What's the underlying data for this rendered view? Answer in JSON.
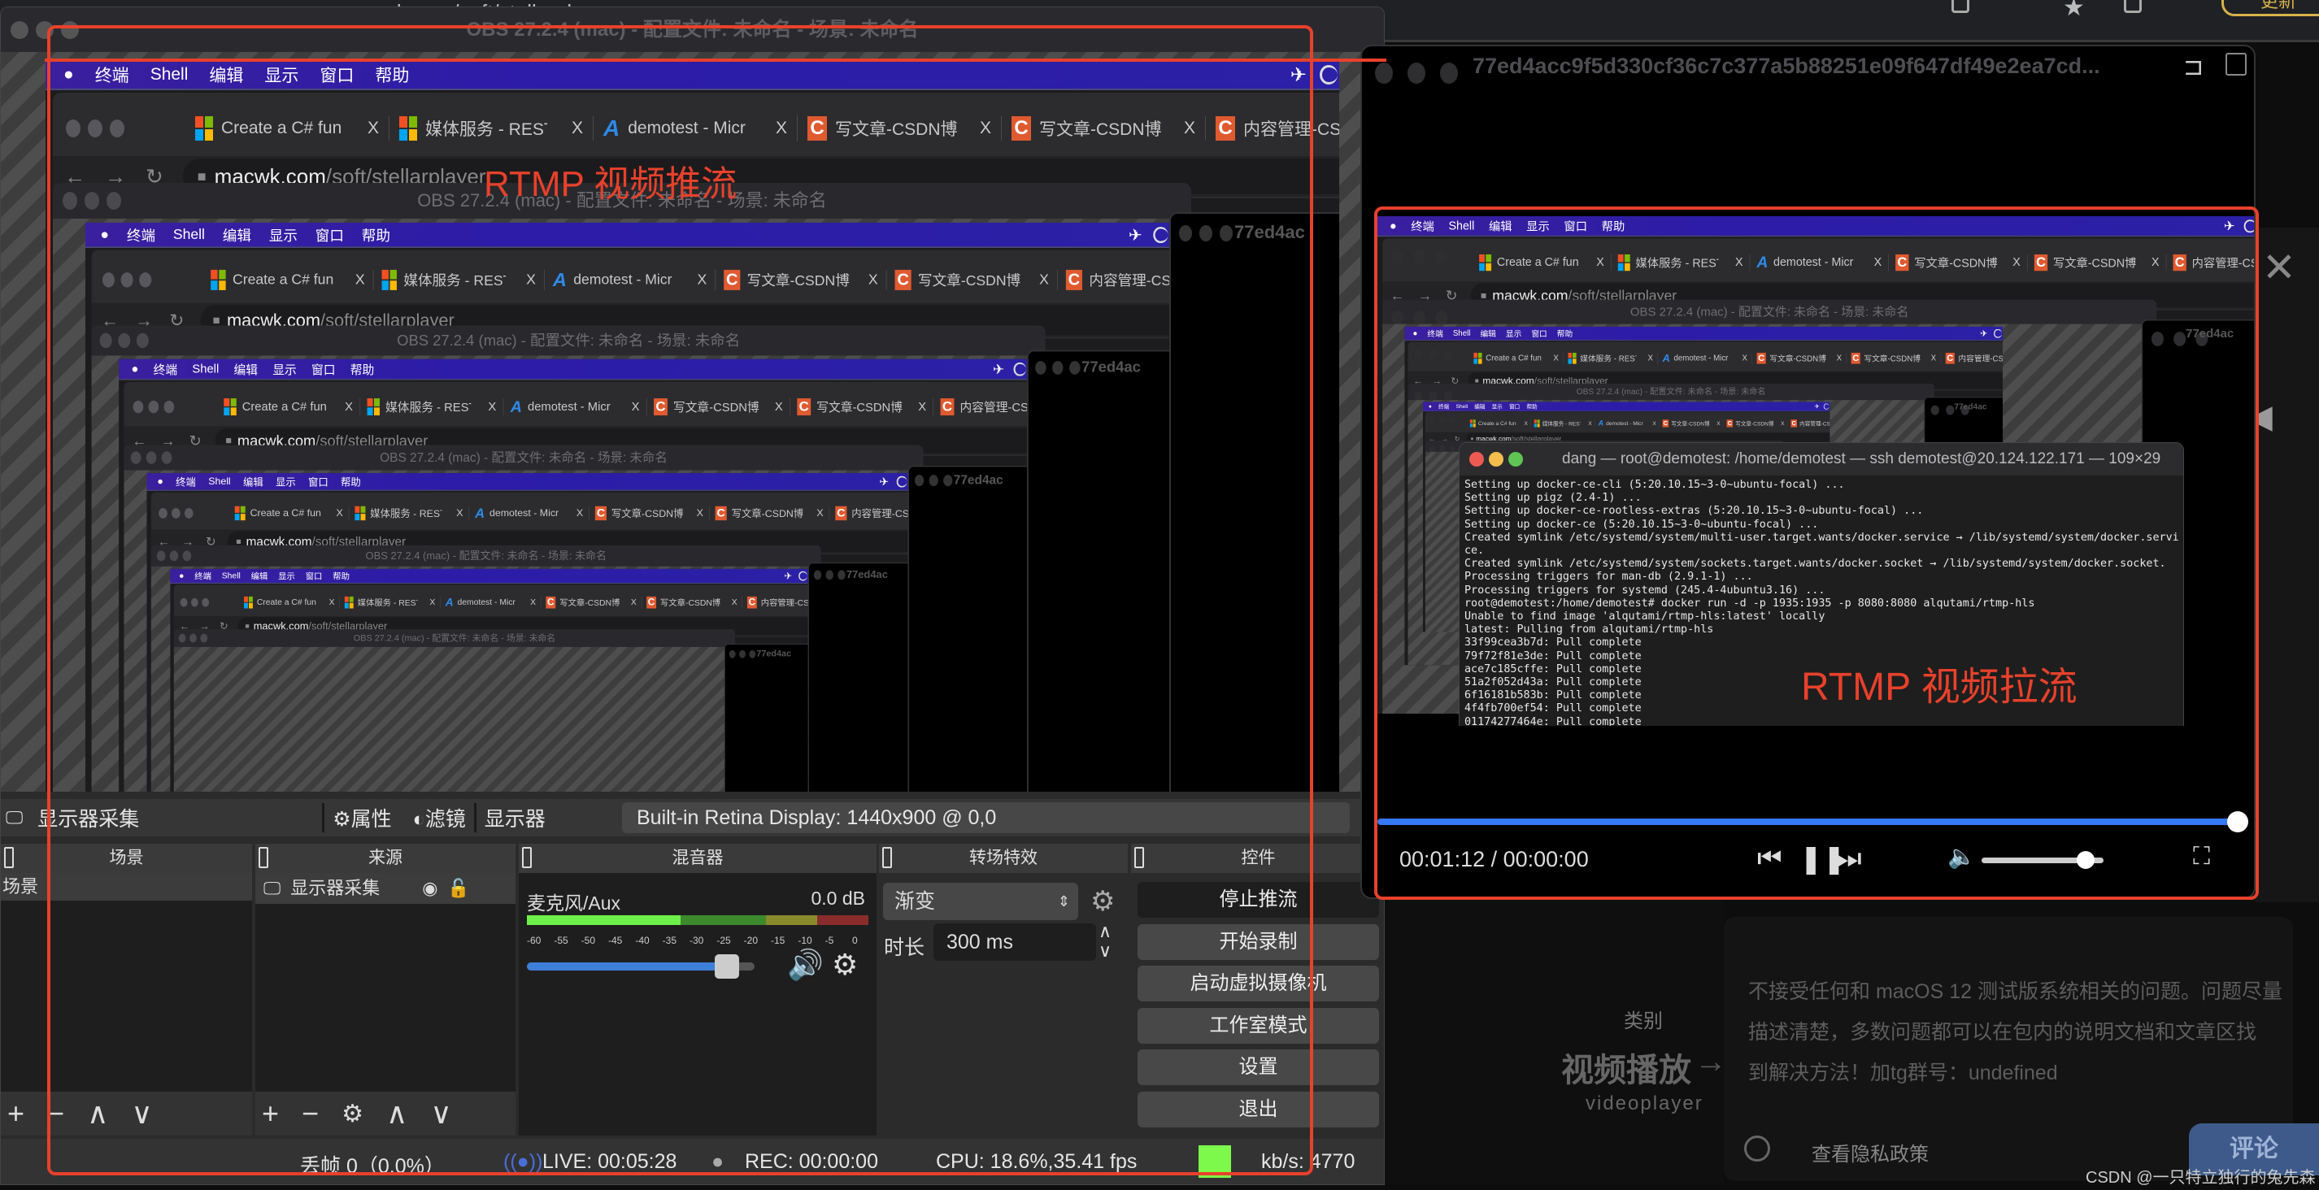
{
  "browser_bg": {
    "url": "macwk.com/soft/stellarplayer",
    "update_label": "更新"
  },
  "obs": {
    "title": "OBS 27.2.4 (mac) - 配置文件: 未命名 - 场景: 未命名",
    "toolbar": {
      "source_name": "显示器采集",
      "properties": "属性",
      "filters": "滤镜",
      "display_label": "显示器",
      "display_value": "Built-in Retina Display: 1440x900 @ 0,0"
    },
    "docks": {
      "scenes": "场景",
      "sources": "来源",
      "mixer": "混音器",
      "transitions": "转场特效",
      "controls": "控件"
    },
    "scenes": [
      "场景"
    ],
    "sources": [
      {
        "name": "显示器采集",
        "visible": true,
        "locked": false
      }
    ],
    "mixer": {
      "channel": "麦克风/Aux",
      "level": "0.0 dB",
      "ticks": [
        "-60",
        "-55",
        "-50",
        "-45",
        "-40",
        "-35",
        "-30",
        "-25",
        "-20",
        "-15",
        "-10",
        "-5",
        "0"
      ],
      "volume": 0.88
    },
    "transitions": {
      "selected": "渐变",
      "duration_label": "时长",
      "duration": "300 ms"
    },
    "controls": [
      "停止推流",
      "开始录制",
      "启动虚拟摄像机",
      "工作室模式",
      "设置",
      "退出"
    ],
    "status": {
      "dropped": "丢帧 0（0.0%）",
      "live": "LIVE: 00:05:28",
      "rec": "REC: 00:00:00",
      "cpu": "CPU: 18.6%,35.41 fps",
      "kbps": "kb/s: 4770",
      "kbps_color": "#7cf94a"
    }
  },
  "screen": {
    "menubar": [
      "终端",
      "Shell",
      "编辑",
      "显示",
      "窗口",
      "帮助"
    ],
    "tabs": [
      {
        "label": "Create a C# fun",
        "icon": "microsoft-icon"
      },
      {
        "label": "媒体服务 - REST",
        "icon": "microsoft-icon"
      },
      {
        "label": "demotest - Micr",
        "icon": "azure-icon"
      },
      {
        "label": "写文章-CSDN博",
        "icon": "csdn-icon"
      },
      {
        "label": "写文章-CSDN博",
        "icon": "csdn-icon"
      },
      {
        "label": "内容管理-CS",
        "icon": "csdn-icon"
      }
    ],
    "url_host": "macwk.com",
    "url_path": "/soft/stellarplayer",
    "player_title": "77ed4ac"
  },
  "player": {
    "title": "77ed4acc9f5d330cf36c7c377a5b88251e09f647df49e2ea7cd...",
    "time": "00:01:12 / 00:00:00",
    "progress": 1.0,
    "volume": 0.85,
    "accent": "#3478f6"
  },
  "terminal": {
    "title": "dang — root@demotest: /home/demotest — ssh demotest@20.124.122.171 — 109×29",
    "lines": [
      "Setting up docker-ce-cli (5:20.10.15~3-0~ubuntu-focal) ...",
      "Setting up pigz (2.4-1) ...",
      "Setting up docker-ce-rootless-extras (5:20.10.15~3-0~ubuntu-focal) ...",
      "Setting up docker-ce (5:20.10.15~3-0~ubuntu-focal) ...",
      "Created symlink /etc/systemd/system/multi-user.target.wants/docker.service → /lib/systemd/system/docker.servi",
      "ce.",
      "Created symlink /etc/systemd/system/sockets.target.wants/docker.socket → /lib/systemd/system/docker.socket.",
      "Processing triggers for man-db (2.9.1-1) ...",
      "Processing triggers for systemd (245.4-4ubuntu3.16) ...",
      "root@demotest:/home/demotest# docker run -d -p 1935:1935 -p 8080:8080 alqutami/rtmp-hls",
      "Unable to find image 'alqutami/rtmp-hls:latest' locally",
      "latest: Pulling from alqutami/rtmp-hls",
      "33f99cea3b7d: Pull complete",
      "79f72f81e3de: Pull complete",
      "ace7c185cffe: Pull complete",
      "51a2f052d43a: Pull complete",
      "6f16181b583b: Pull complete",
      "4f4fb700ef54: Pull complete",
      "01174277464e: Pull complete"
    ]
  },
  "annotations": {
    "push": "RTMP 视频推流",
    "pull": "RTMP 视频拉流",
    "color": "#e8412b"
  },
  "page": {
    "category_label": "类别",
    "category": "视频播放",
    "category_en": "videoplayer",
    "notice_lines": [
      "不接受任何和 macOS 12 测试版系统相关的问题。问题尽量",
      "描述清楚，多数问题都可以在包内的说明文档和文章区找",
      "到解决方法！加tg群号：undefined"
    ],
    "privacy": "查看隐私政策",
    "comment": "评论",
    "watermark": "CSDN @一只特立独行的兔先森"
  }
}
